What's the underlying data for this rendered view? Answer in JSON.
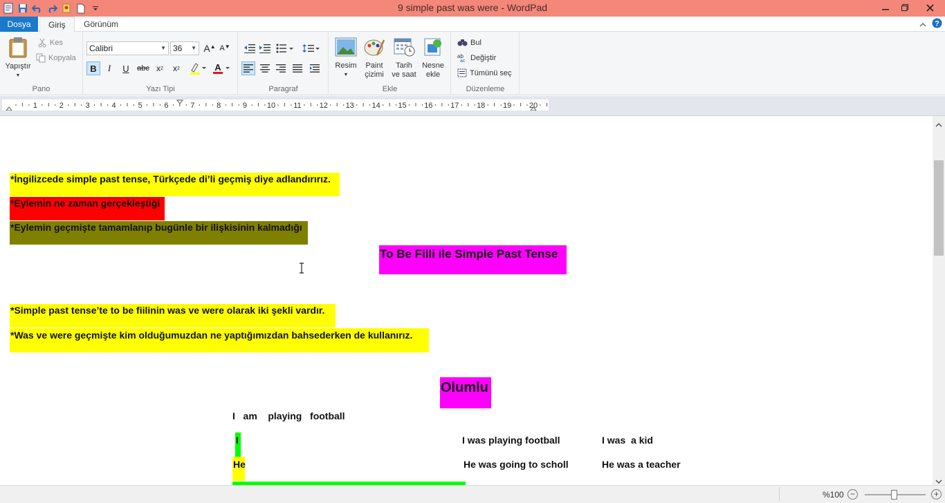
{
  "window": {
    "title": "9  simple past was were - WordPad"
  },
  "qat": {
    "save_icon": "save-icon",
    "undo_icon": "undo-icon",
    "redo_icon": "redo-icon"
  },
  "tabs": {
    "file": "Dosya",
    "home": "Giriş",
    "view": "Görünüm"
  },
  "ribbon": {
    "clipboard": {
      "label": "Pano",
      "paste": "Yapıştır",
      "cut": "Kes",
      "copy": "Kopyala"
    },
    "font": {
      "label": "Yazı Tipi",
      "family": "Calibri",
      "size": "36"
    },
    "paragraph": {
      "label": "Paragraf"
    },
    "insert": {
      "label": "Ekle",
      "picture": "Resim",
      "paint1": "Paint",
      "paint2": "çizimi",
      "date1": "Tarih",
      "date2": "ve saat",
      "object1": "Nesne",
      "object2": "ekle"
    },
    "editing": {
      "label": "Düzenleme",
      "find": "Bul",
      "replace": "Değiştir",
      "select_all": "Tümünü seç"
    }
  },
  "ruler": {
    "numbers": [
      "1",
      "2",
      "3",
      "4",
      "5",
      "6",
      "7",
      "8",
      "9",
      "10",
      "11",
      "12",
      "13",
      "14",
      "15",
      "16",
      "17",
      "18",
      "19",
      "20"
    ]
  },
  "document": {
    "line1": "*İngilizcede simple past  tense, Türkçede di’li geçmiş  diye adlandırırız.",
    "line2": "*Eylemin ne zaman gerçekleştiği",
    "line3": "*Eylemin geçmişte tamamlanıp bugünle bir ilişkisinin kalmadığı",
    "heading1": "To Be Fiili ile Simple Past Tense",
    "line4": "*Simple past tense’te to be fiilinin was ve were olarak iki şekli vardır.",
    "line5": "*Was ve were  geçmişte kim olduğumuzdan ne yaptığımızdan bahsederken  de kullanırız.",
    "heading2": "Olumlu",
    "example1": "I   am    playing   football",
    "pronoun_i": "I",
    "example2": "I was playing football",
    "example3": "I was  a kid",
    "pronoun_he": "He",
    "example4": "He was going to scholl",
    "example5": "He was a teacher"
  },
  "status": {
    "zoom": "%100"
  },
  "colors": {
    "titlebar": "#f2877a",
    "file_tab": "#1979ca",
    "highlight_yellow": "#ffff00",
    "highlight_red": "#ff0000",
    "highlight_olive": "#808000",
    "highlight_magenta": "#ff00ff",
    "highlight_green": "#00ff00"
  }
}
